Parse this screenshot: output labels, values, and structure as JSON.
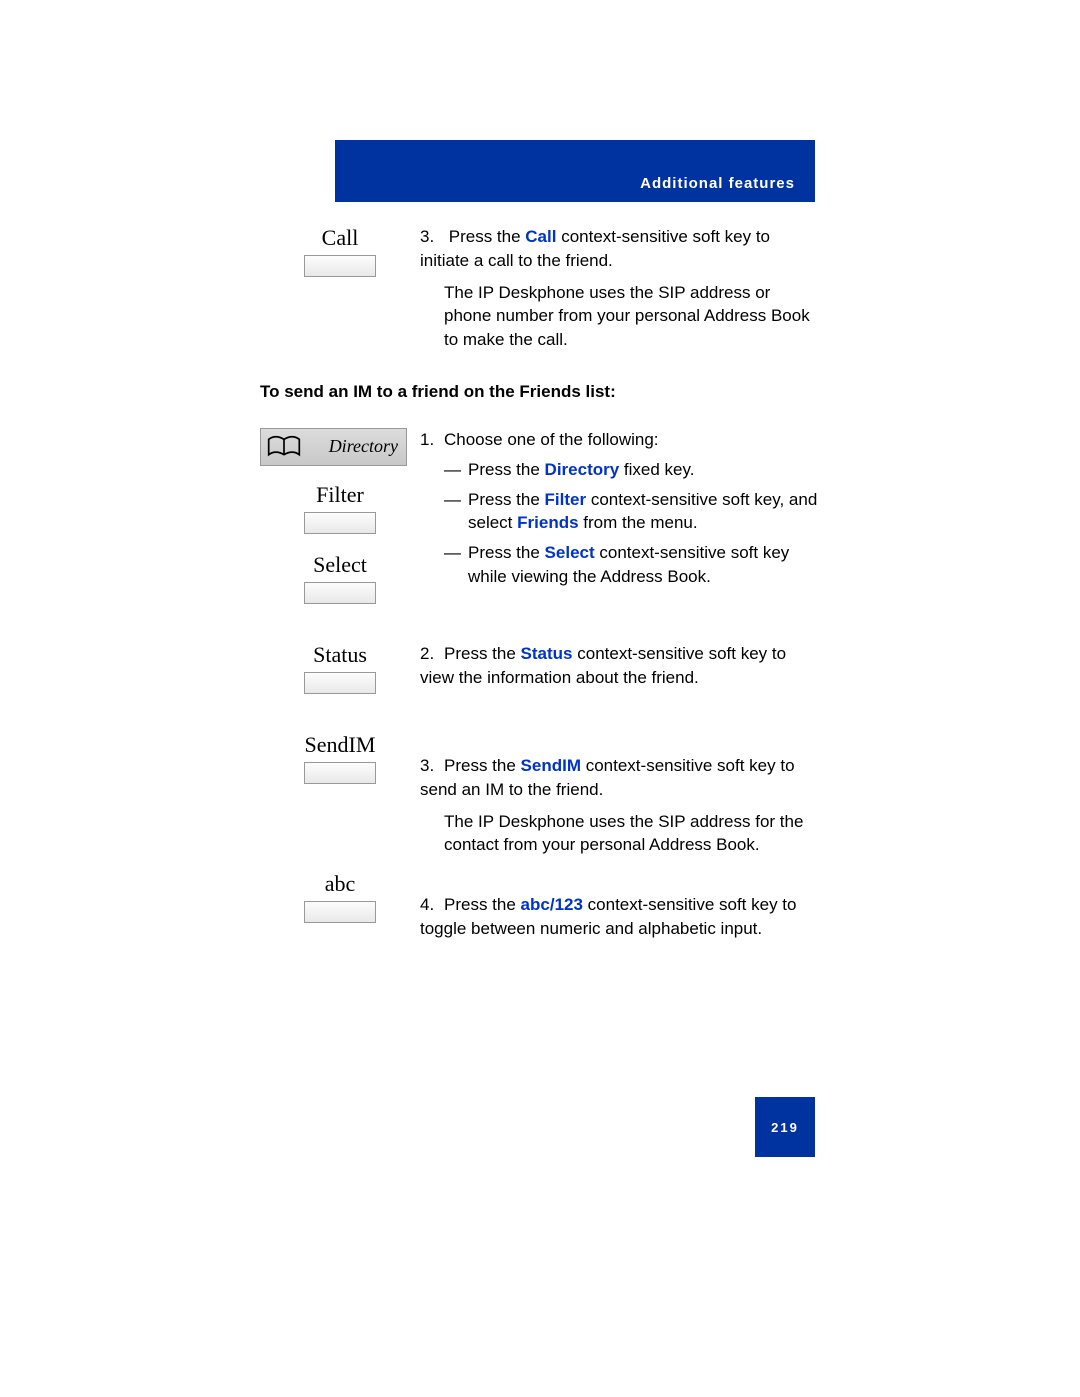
{
  "header": {
    "title": "Additional features"
  },
  "call_section": {
    "key_label": "Call",
    "step_num": "3.",
    "step_text_a": "Press the ",
    "step_link": "Call",
    "step_text_b": " context-sensitive soft key to initiate a call to the friend.",
    "para2": "The IP Deskphone uses the SIP address or phone number from your personal Address Book to make the call."
  },
  "section_heading": "To send an IM to a friend on the Friends list:",
  "directory_label": "Directory",
  "keys": {
    "filter": "Filter",
    "select": "Select",
    "status": "Status",
    "sendim": "SendIM",
    "abc": "abc"
  },
  "step1": {
    "num": "1.",
    "intro": "Choose one of the following:",
    "d1_a": "Press the ",
    "d1_link": "Directory",
    "d1_b": " fixed key.",
    "d2_a": "Press the ",
    "d2_link": "Filter",
    "d2_b": " context-sensitive soft key, and select ",
    "d2_link2": "Friends",
    "d2_c": " from the menu.",
    "d3_a": "Press the ",
    "d3_link": "Select",
    "d3_b": " context-sensitive soft key while viewing the Address Book."
  },
  "step2": {
    "num": "2.",
    "a": "Press the ",
    "link": "Status",
    "b": " context-sensitive soft key to view the information about the friend."
  },
  "step3": {
    "num": "3.",
    "a": "Press the ",
    "link": "SendIM",
    "b": " context-sensitive soft key to send an IM to the friend.",
    "para2": "The IP Deskphone uses the SIP address for the contact from your personal Address Book."
  },
  "step4": {
    "num": "4.",
    "a": "Press the ",
    "link": "abc/123",
    "b": " context-sensitive soft key to toggle between numeric and alphabetic input."
  },
  "page_number": "219"
}
